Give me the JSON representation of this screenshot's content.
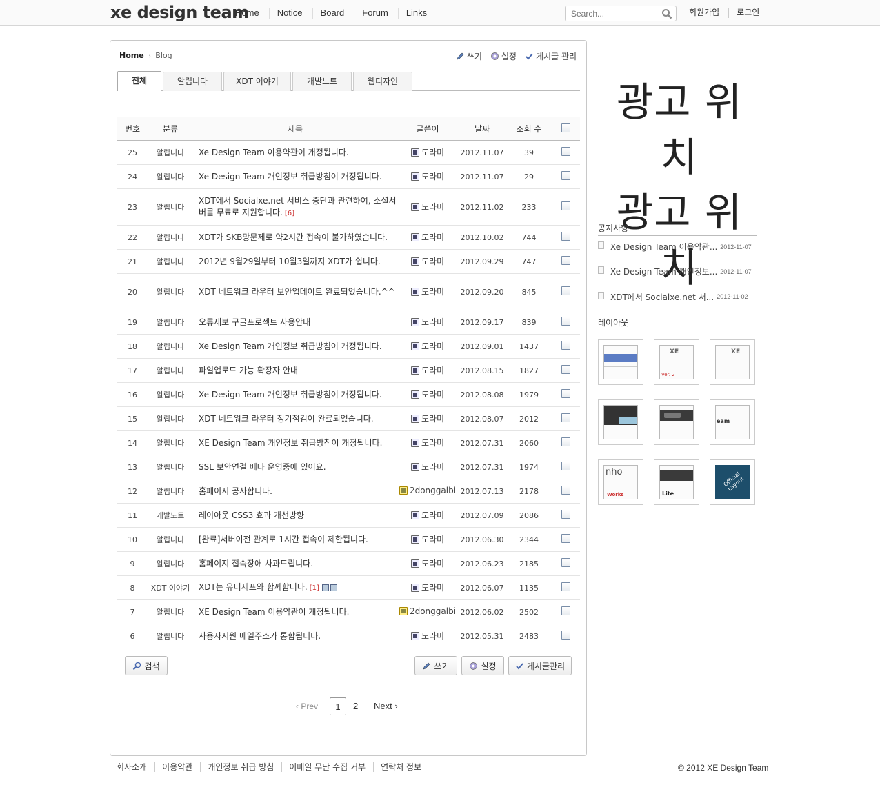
{
  "header": {
    "logo": "xe design team",
    "nav": [
      "Home",
      "Notice",
      "Board",
      "Forum",
      "Links"
    ],
    "search_placeholder": "Search...",
    "signup": "회원가입",
    "login": "로그인"
  },
  "breadcrumb": {
    "home": "Home",
    "sep": "›",
    "current": "Blog"
  },
  "top_actions": {
    "write": "쓰기",
    "settings": "설정",
    "manage": "게시글 관리"
  },
  "tabs": [
    "전체",
    "알립니다",
    "XDT 이야기",
    "개발노트",
    "웹디자인"
  ],
  "table": {
    "headers": {
      "no": "번호",
      "category": "분류",
      "title": "제목",
      "author": "글쓴이",
      "date": "날짜",
      "views": "조회 수"
    },
    "rows": [
      {
        "no": "25",
        "category": "알립니다",
        "title": "Xe Design Team 이용약관이 개정됩니다.",
        "author": "도라미",
        "date": "2012.11.07",
        "views": "39"
      },
      {
        "no": "24",
        "category": "알립니다",
        "title": "Xe Design Team 개인정보 취급방침이 개정됩니다.",
        "author": "도라미",
        "date": "2012.11.07",
        "views": "29"
      },
      {
        "no": "23",
        "category": "알립니다",
        "title": "XDT에서 Socialxe.net 서비스 중단과 관련하여, 소셜서버를 무료로 지원합니다.",
        "comments": "[6]",
        "author": "도라미",
        "date": "2012.11.02",
        "views": "233"
      },
      {
        "no": "22",
        "category": "알립니다",
        "title": "XDT가 SKB망문제로 약2시간 접속이 불가하였습니다.",
        "author": "도라미",
        "date": "2012.10.02",
        "views": "744"
      },
      {
        "no": "21",
        "category": "알립니다",
        "title": "2012년 9월29일부터 10월3일까지 XDT가 쉽니다.",
        "author": "도라미",
        "date": "2012.09.29",
        "views": "747"
      },
      {
        "no": "20",
        "category": "알립니다",
        "title": "XDT 네트워크 라우터 보안업데이트 완료되었습니다.^^",
        "author": "도라미",
        "date": "2012.09.20",
        "views": "845"
      },
      {
        "no": "19",
        "category": "알립니다",
        "title": "오류제보 구글프로젝트 사용안내",
        "author": "도라미",
        "date": "2012.09.17",
        "views": "839"
      },
      {
        "no": "18",
        "category": "알립니다",
        "title": "Xe Design Team 개인정보 취급방침이 개정됩니다.",
        "author": "도라미",
        "date": "2012.09.01",
        "views": "1437"
      },
      {
        "no": "17",
        "category": "알립니다",
        "title": "파일업로드 가능 확장자 안내",
        "author": "도라미",
        "date": "2012.08.15",
        "views": "1827"
      },
      {
        "no": "16",
        "category": "알립니다",
        "title": "Xe Design Team 개인정보 취급방침이 개정됩니다.",
        "author": "도라미",
        "date": "2012.08.08",
        "views": "1979"
      },
      {
        "no": "15",
        "category": "알립니다",
        "title": "XDT 네트워크 라우터 정기점검이 완료되었습니다.",
        "author": "도라미",
        "date": "2012.08.07",
        "views": "2012"
      },
      {
        "no": "14",
        "category": "알립니다",
        "title": "XE Design Team 개인정보 취급방침이 개정됩니다.",
        "author": "도라미",
        "date": "2012.07.31",
        "views": "2060"
      },
      {
        "no": "13",
        "category": "알립니다",
        "title": "SSL 보안연결 베타 운영중에 있어요.",
        "author": "도라미",
        "date": "2012.07.31",
        "views": "1974"
      },
      {
        "no": "12",
        "category": "알립니다",
        "title": "홈페이지 공사합니다.",
        "author": "2donggalbi",
        "date": "2012.07.13",
        "views": "2178"
      },
      {
        "no": "11",
        "category": "개발노트",
        "title": "레이아웃 CSS3 효과 개선방향",
        "author": "도라미",
        "date": "2012.07.09",
        "views": "2086"
      },
      {
        "no": "10",
        "category": "알립니다",
        "title": "[완료]서버이전 관계로 1시간 접속이 제한됩니다.",
        "author": "도라미",
        "date": "2012.06.30",
        "views": "2344"
      },
      {
        "no": "9",
        "category": "알립니다",
        "title": "홈페이지 접속장애 사과드립니다.",
        "author": "도라미",
        "date": "2012.06.23",
        "views": "2185"
      },
      {
        "no": "8",
        "category": "XDT 이야기",
        "title": "XDT는 유니세프와 함께합니다.",
        "comments": "[1]",
        "author": "도라미",
        "date": "2012.06.07",
        "views": "1135"
      },
      {
        "no": "7",
        "category": "알립니다",
        "title": "XE Design Team 이용약관이 개정됩니다.",
        "author": "2donggalbi",
        "date": "2012.06.02",
        "views": "2502"
      },
      {
        "no": "6",
        "category": "알립니다",
        "title": "사용자지원 메일주소가 통합됩니다.",
        "author": "도라미",
        "date": "2012.05.31",
        "views": "2483"
      }
    ]
  },
  "buttons": {
    "search": "검색",
    "write": "쓰기",
    "settings": "설정",
    "manage": "게시글관리"
  },
  "pagination": {
    "prev": "‹ Prev",
    "pages": [
      "1",
      "2"
    ],
    "next": "Next ›"
  },
  "sidebar": {
    "ad_line1": "광고 위치",
    "ad_line2": "광고 위치",
    "notice_title": "공지사항",
    "notices": [
      {
        "title": "Xe Design Team 이용약관...",
        "date": "2012-11-07"
      },
      {
        "title": "Xe Design Team 개인정보...",
        "date": "2012-11-07"
      },
      {
        "title": "XDT에서 Socialxe.net 서...",
        "date": "2012-11-02"
      }
    ],
    "layout_title": "레이아웃",
    "thumb_labels": {
      "t2": "XE",
      "t2b": "Ver. 2",
      "t3": "XE",
      "t6": "eam",
      "t7": "nho",
      "t7b": "Works",
      "t8": "Lite",
      "t9": "Official Layout"
    }
  },
  "footer": {
    "links": [
      "회사소개",
      "이용약관",
      "개인정보 취급 방침",
      "이메일 무단 수집 거부",
      "연락처 정보"
    ],
    "copyright": "© 2012 XE Design Team"
  },
  "colors": {
    "tab_active_bg": "#ffffff",
    "comment_count": "#cc3333",
    "official_tile": "#1d4e6b"
  }
}
